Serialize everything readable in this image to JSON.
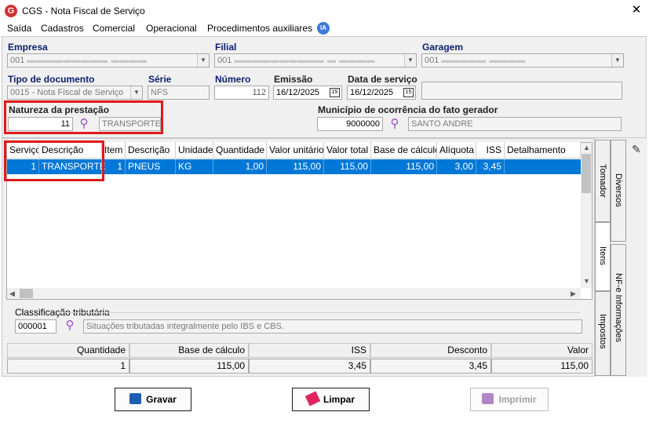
{
  "window": {
    "title": "CGS - Nota Fiscal de Serviço",
    "logo": "G",
    "close": "✕"
  },
  "menu": {
    "items": [
      "Saída",
      "Cadastros",
      "Comercial",
      "Operacional",
      "Procedimentos auxiliares"
    ],
    "ia_badge": "IA"
  },
  "header": {
    "empresa": {
      "label": "Empresa",
      "value": "001"
    },
    "filial": {
      "label": "Filial",
      "value": "001"
    },
    "garagem": {
      "label": "Garagem",
      "value": "001"
    },
    "tipo_documento": {
      "label": "Tipo de documento",
      "value": "0015 - Nota Fiscal de Serviço"
    },
    "serie": {
      "label": "Série",
      "value": "NFS"
    },
    "numero": {
      "label": "Número",
      "value": "112"
    },
    "emissao": {
      "label": "Emissão",
      "value": "16/12/2025"
    },
    "data_servico": {
      "label": "Data de serviço",
      "value": "16/12/2025"
    },
    "natureza": {
      "label": "Natureza da prestação",
      "code": "11",
      "description": "TRANSPORTE"
    },
    "municipio": {
      "label": "Município de ocorrência do fato gerador",
      "code": "9000000",
      "description": "SANTO ANDRE"
    }
  },
  "grid": {
    "columns": [
      "Serviço",
      "Descrição",
      "Item",
      "Descrição",
      "Unidade",
      "Quantidade",
      "Valor unitário",
      "Valor total",
      "Base de cálculo",
      "Alíquota",
      "ISS",
      "Detalhamento"
    ],
    "rows": [
      {
        "servico": "1",
        "descricao": "TRANSPORTE",
        "item": "1",
        "descricao_item": "PNEUS",
        "unidade": "KG",
        "quantidade": "1,00",
        "valor_unitario": "115,00",
        "valor_total": "115,00",
        "base_calculo": "115,00",
        "aliquota": "3,00",
        "iss": "3,45",
        "detalhamento": ""
      }
    ]
  },
  "classificacao": {
    "label": "Classificação tributária",
    "code": "000001",
    "description": "Situações tributadas integralmente pelo IBS e CBS."
  },
  "totals": {
    "headers": [
      "Quantidade",
      "Base de cálculo",
      "ISS",
      "Desconto",
      "Valor"
    ],
    "values": [
      "1",
      "115,00",
      "3,45",
      "3,45",
      "115,00"
    ]
  },
  "tabs": {
    "tomador": "Tomador",
    "diversos": "Diversos",
    "itens": "Itens",
    "nfe_info": "NF-e Informações",
    "impostos": "Impostos"
  },
  "buttons": {
    "gravar": "Gravar",
    "limpar": "Limpar",
    "imprimir": "Imprimir"
  },
  "colors": {
    "accent": "#0078d7",
    "label": "#0b1f6b",
    "highlight_box": "#e01b1b",
    "search_icon": "#9b4dca"
  }
}
